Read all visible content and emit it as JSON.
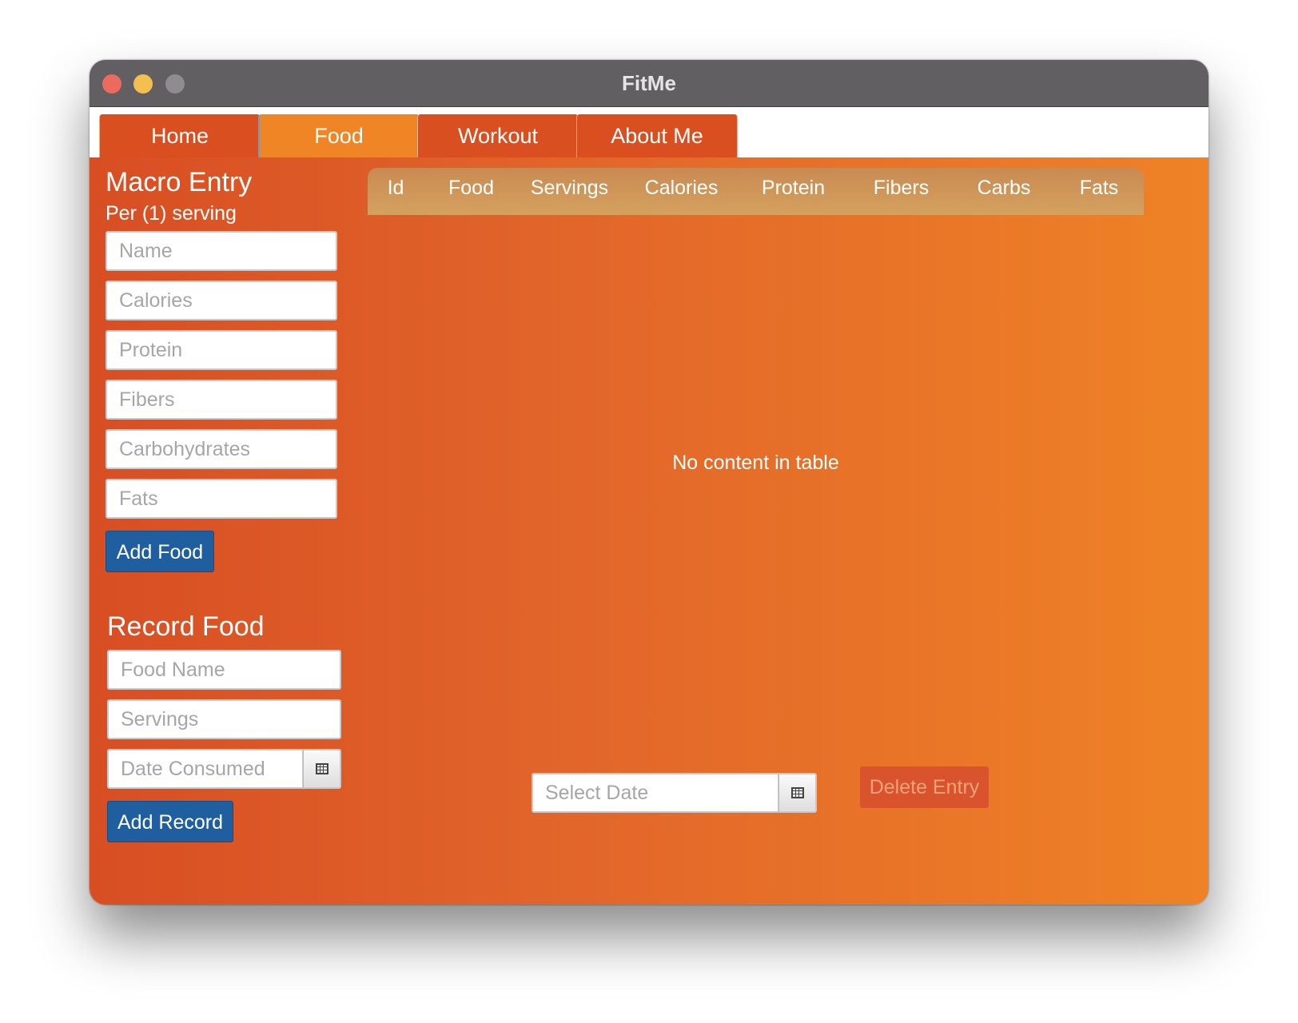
{
  "window": {
    "title": "FitMe"
  },
  "tabs": [
    {
      "label": "Home"
    },
    {
      "label": "Food"
    },
    {
      "label": "Workout"
    },
    {
      "label": "About Me"
    }
  ],
  "macro_entry": {
    "title": "Macro Entry",
    "subtitle": "Per (1) serving",
    "fields": {
      "name": "Name",
      "calories": "Calories",
      "protein": "Protein",
      "fibers": "Fibers",
      "carbohydrates": "Carbohydrates",
      "fats": "Fats"
    },
    "add_button": "Add Food"
  },
  "record_food": {
    "title": "Record Food",
    "fields": {
      "food_name": "Food Name",
      "servings": "Servings",
      "date_consumed": "Date Consumed"
    },
    "add_button": "Add Record"
  },
  "table": {
    "columns": [
      "Id",
      "Food",
      "Servings",
      "Calories",
      "Protein",
      "Fibers",
      "Carbs",
      "Fats"
    ],
    "rows": [],
    "empty_message": "No content in table"
  },
  "footer": {
    "select_date_placeholder": "Select Date",
    "delete_button": "Delete Entry"
  },
  "colors": {
    "tab": "#d94f20",
    "tab_active": "#f08526",
    "button_blue": "#1f5fa0",
    "delete_button": "#d9532d"
  },
  "icons": {
    "calendar": "calendar-icon"
  }
}
